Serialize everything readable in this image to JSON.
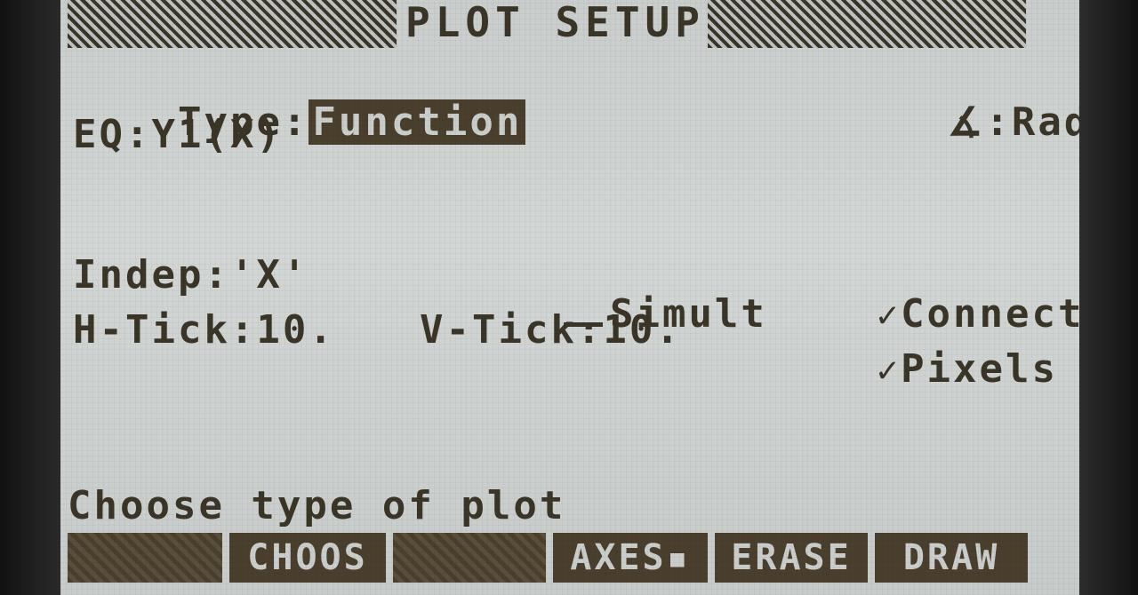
{
  "title": "PLOT SETUP",
  "type_label": "Type:",
  "type_value": "Function",
  "angle": {
    "icon": "angle-icon",
    "value": ":Rad"
  },
  "eq": "EQ:Y1(X)",
  "indep": "Indep:'X'",
  "simult": "Simult",
  "connect": "Connect",
  "htick": "H-Tick:10.",
  "vtick": "V-Tick:10.",
  "pixels": "Pixels",
  "prompt": "Choose type of plot",
  "softkeys": [
    "",
    "CHOOS",
    "",
    "AXES",
    "ERASE",
    "DRAW"
  ],
  "colors": {
    "lcd_bg": "#c9cdcc",
    "lcd_ink": "#3a3526"
  }
}
